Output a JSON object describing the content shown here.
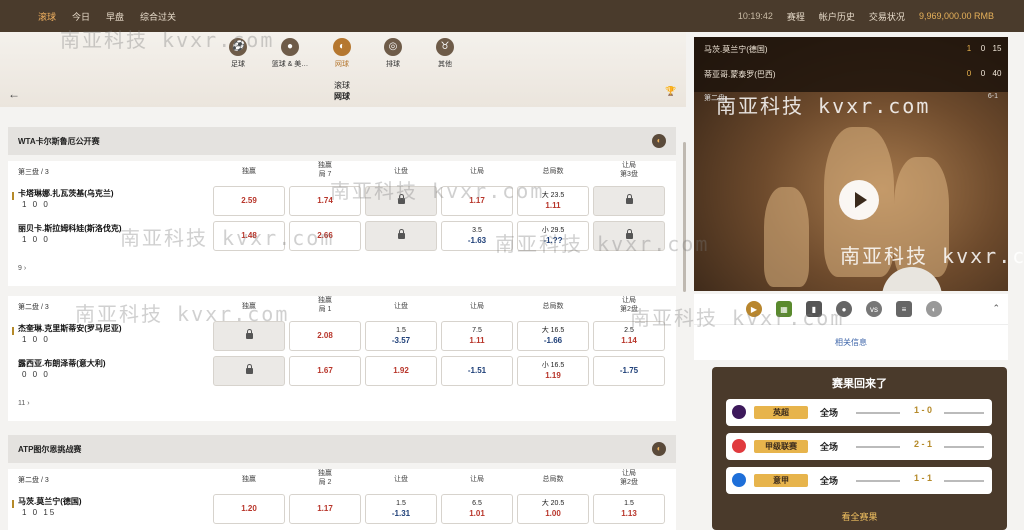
{
  "topbar": {
    "nav": [
      "滚球",
      "今日",
      "早盘",
      "综合过关"
    ],
    "time": "10:19:42",
    "links": [
      "赛程",
      "帐户历史",
      "交易状况"
    ],
    "balance": "9,969,000.00 RMB"
  },
  "sports": [
    {
      "label": "足球",
      "icon": "soccer-icon"
    },
    {
      "label": "篮球 & 美…",
      "icon": "basketball-icon"
    },
    {
      "label": "网球",
      "icon": "tennis-icon"
    },
    {
      "label": "排球",
      "icon": "volleyball-icon"
    },
    {
      "label": "其他",
      "icon": "other-icon"
    }
  ],
  "page": {
    "line1": "滚球",
    "line2": "网球"
  },
  "leagues": [
    {
      "name": "WTA卡尔斯鲁厄公开赛",
      "matches": [
        {
          "set": "第三盘 / 3",
          "cols": [
            "独赢",
            "独赢\n局 7",
            "让盘",
            "让局",
            "总局数",
            "让局\n第3盘"
          ],
          "p1": {
            "name": "卡塔琳娜.扎瓦茨基(乌克兰)",
            "score": "1  0  0"
          },
          "p2": {
            "name": "丽贝卡.斯拉姆科娃(斯洛伐克)",
            "score": "1  0  0"
          },
          "r1": [
            {
              "v": "2.59",
              "c": "red"
            },
            {
              "v": "1.74",
              "c": "red"
            },
            {
              "lock": true
            },
            {
              "v": "1.17",
              "c": "red"
            },
            {
              "t": "大 23.5",
              "v": "1.11",
              "c": "red"
            },
            {
              "lock": true
            }
          ],
          "r2": [
            {
              "v": "1.48",
              "c": "red"
            },
            {
              "v": "2.66",
              "c": "red"
            },
            {
              "lock": true
            },
            {
              "t": "3.5",
              "v": "-1.63",
              "c": "blue"
            },
            {
              "t": "小 29.5",
              "v": "-1.??",
              "c": "blue"
            },
            {
              "lock": true
            }
          ],
          "more": "9 ›"
        },
        {
          "set": "第二盘 / 3",
          "cols": [
            "独赢",
            "独赢\n局 1",
            "让盘",
            "让局",
            "总局数",
            "让局\n第2盘"
          ],
          "p1": {
            "name": "杰奎琳.克里斯蒂安(罗马尼亚)",
            "score": "1  0  0"
          },
          "p2": {
            "name": "露西亚.布朗泽蒂(意大利)",
            "score": "0  0  0"
          },
          "r1": [
            {
              "lock": true
            },
            {
              "v": "2.08",
              "c": "red"
            },
            {
              "t": "1.5",
              "v": "-3.57",
              "c": "blue"
            },
            {
              "t": "7.5",
              "v": "1.11",
              "c": "red"
            },
            {
              "t": "大 16.5",
              "v": "-1.66",
              "c": "blue"
            },
            {
              "t": "2.5",
              "v": "1.14",
              "c": "red"
            }
          ],
          "r2": [
            {
              "lock": true
            },
            {
              "v": "1.67",
              "c": "red"
            },
            {
              "v": "1.92",
              "c": "red"
            },
            {
              "v": "-1.51",
              "c": "blue"
            },
            {
              "t": "小 16.5",
              "v": "1.19",
              "c": "red"
            },
            {
              "v": "-1.75",
              "c": "blue"
            }
          ],
          "more": "11 ›"
        }
      ]
    },
    {
      "name": "ATP图尔恩挑战赛",
      "matches": [
        {
          "set": "第二盘 / 3",
          "cols": [
            "独赢",
            "独赢\n局 2",
            "让盘",
            "让局",
            "总局数",
            "让局\n第2盘"
          ],
          "p1": {
            "name": "马茨.莫兰宁(德国)",
            "score": "1  0  15"
          },
          "r1": [
            {
              "v": "1.20",
              "c": "red"
            },
            {
              "v": "1.17",
              "c": "red"
            },
            {
              "t": "1.5",
              "v": "-1.31",
              "c": "blue"
            },
            {
              "t": "6.5",
              "v": "1.01",
              "c": "red"
            },
            {
              "t": "大 20.5",
              "v": "1.00",
              "c": "red"
            },
            {
              "t": "1.5",
              "v": "1.13",
              "c": "red"
            }
          ]
        }
      ]
    }
  ],
  "video": {
    "team1": {
      "name": "马茨.莫兰宁(德国)",
      "s": [
        "1",
        "0",
        "15"
      ]
    },
    "team2": {
      "name": "蒂亚哥.蒙泰罗(巴西)",
      "s": [
        "0",
        "0",
        "40"
      ]
    },
    "label": "第二盘",
    "set_score": "6-1"
  },
  "related": "相关信息",
  "results": {
    "title": "赛果回来了",
    "rows": [
      {
        "league": "英超",
        "period": "全场",
        "score": "1 - 0",
        "color": "#3d195b"
      },
      {
        "league": "甲级联赛",
        "period": "全场",
        "score": "2 - 1",
        "color": "#e03a3e"
      },
      {
        "league": "意甲",
        "period": "全场",
        "score": "1 - 1",
        "color": "#1e6fd9"
      }
    ],
    "see_all": "看全赛果"
  },
  "watermark": "南亚科技 kvxr.com"
}
